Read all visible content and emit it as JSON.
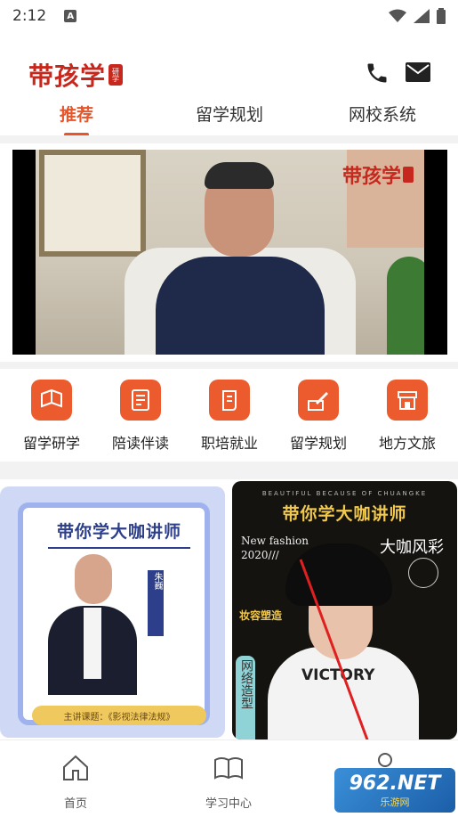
{
  "status_bar": {
    "time": "2:12",
    "notification_letter": "A"
  },
  "header": {
    "logo_text": "带孩学",
    "logo_seal": "研学"
  },
  "tabs": [
    {
      "label": "推荐",
      "active": true
    },
    {
      "label": "留学规划",
      "active": false
    },
    {
      "label": "网校系统",
      "active": false
    }
  ],
  "banner": {
    "logo_text": "带孩学"
  },
  "categories": [
    {
      "label": "留学研学",
      "icon": "book-icon"
    },
    {
      "label": "陪读伴读",
      "icon": "document-icon"
    },
    {
      "label": "职培就业",
      "icon": "scroll-icon"
    },
    {
      "label": "留学规划",
      "icon": "pen-icon"
    },
    {
      "label": "地方文旅",
      "icon": "store-icon"
    }
  ],
  "card_left": {
    "title": "带你学大咖讲师",
    "teacher_name": "朱巍",
    "course": "主讲课题：《影视法律法规》"
  },
  "card_right": {
    "top_text": "BEAUTIFUL BECAUSE OF CHUANGKE",
    "title": "带你学大咖讲师",
    "new_fashion": "New fashion",
    "year": "2020///",
    "side_title": "大咖风彩",
    "makeup": "妆容塑造",
    "vertical_text": "网络造型",
    "shirt_text": "VICTORY"
  },
  "bottom_nav": [
    {
      "label": "首页",
      "icon": "home-icon"
    },
    {
      "label": "学习中心",
      "icon": "book-open-icon"
    }
  ],
  "watermark": {
    "big": "962.NET",
    "small": "乐游网"
  },
  "colors": {
    "accent": "#e8552a",
    "brand_red": "#c7281e",
    "category_bg": "#ec5b2e"
  }
}
